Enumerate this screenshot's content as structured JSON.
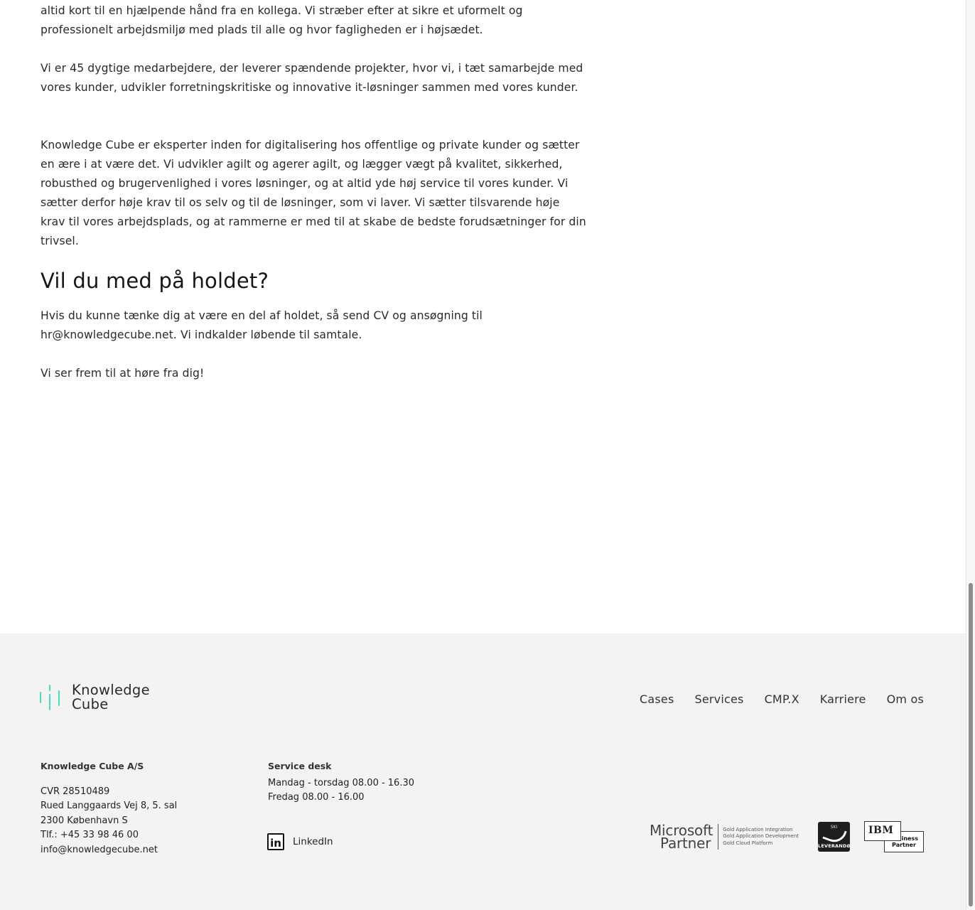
{
  "article": {
    "p1": "altid kort til en hjælpende hånd fra en kollega. Vi stræber efter at sikre et uformelt og professionelt arbejdsmiljø med plads til alle og hvor fagligheden er i højsædet.",
    "p2": "Vi er 45 dygtige medarbejdere, der leverer spændende projekter, hvor vi, i tæt samarbejde med vores kunder, udvikler forretningskritiske og innovative it-løsninger sammen med vores kunder.",
    "p3": "Knowledge Cube er eksperter inden for digitalisering hos offentlige og private kunder og sætter en ære i at være det. Vi udvikler agilt og agerer agilt, og lægger vægt på kvalitet, sikkerhed, robusthed og brugervenlighed i vores løsninger, og at altid yde høj service til vores kunder. Vi sætter derfor høje krav til os selv og til de løsninger, som vi laver. Vi sætter tilsvarende høje krav til vores arbejdsplads, og at rammerne er med til at skabe de bedste forudsætninger for din trivsel.",
    "heading": "Vil du med på holdet?",
    "p4": "Hvis du kunne tænke dig at være en del af holdet, så send CV og ansøgning til hr@knowledgecube.net. Vi indkalder løbende til samtale.",
    "p5": "Vi ser frem til at høre fra dig!"
  },
  "footer": {
    "logo": {
      "line1": "Knowledge",
      "line2": "Cube",
      "accent": "#3ee0c4"
    },
    "nav": [
      "Cases",
      "Services",
      "CMP.X",
      "Karriere",
      "Om os"
    ],
    "company": {
      "title": "Knowledge Cube A/S",
      "cvr": "CVR 28510489",
      "address": "Rued Langgaards Vej 8, 5. sal",
      "city": "2300 København S",
      "phone": "Tlf.: +45 33 98 46 00",
      "email": "info@knowledgecube.net"
    },
    "service": {
      "title": "Service desk",
      "hours1": "Mandag - torsdag 08.00 - 16.30",
      "hours2": "Fredag 08.00 - 16.00"
    },
    "social": {
      "icon": "linkedin-icon",
      "icon_text": "in",
      "label": "LinkedIn"
    },
    "badges": {
      "microsoft": {
        "line1": "Microsoft",
        "line2": "Partner",
        "competencies": [
          "Gold Application Integration",
          "Gold Application Development",
          "Gold Cloud Platform"
        ]
      },
      "sky": {
        "top": "SKI",
        "bottom": "LEVERANDØR"
      },
      "ibm": {
        "mark": "IBM",
        "line1": "Business",
        "line2": "Partner"
      }
    }
  }
}
